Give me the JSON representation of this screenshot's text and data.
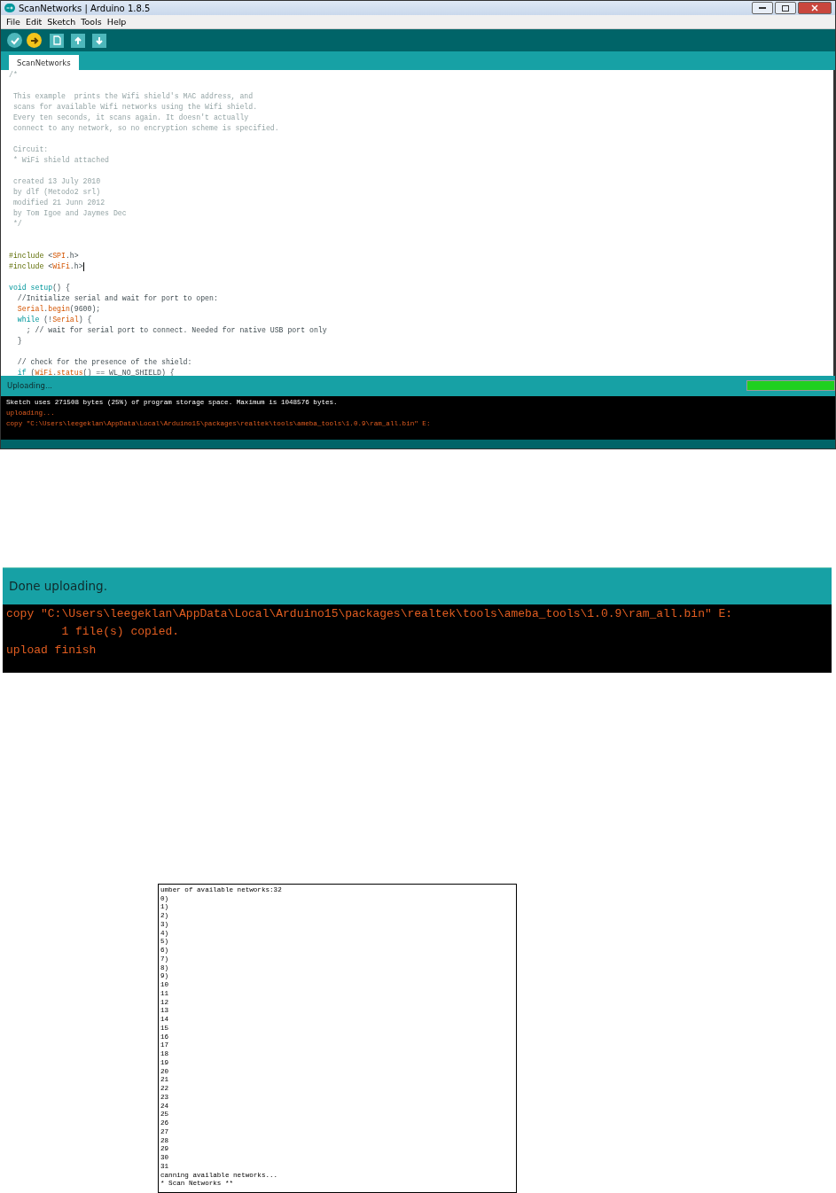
{
  "ide": {
    "window": {
      "title": "ScanNetworks | Arduino 1.8.5"
    },
    "menu": [
      "File",
      "Edit",
      "Sketch",
      "Tools",
      "Help"
    ],
    "toolbar": [
      {
        "kind": "verify",
        "active": false
      },
      {
        "kind": "upload",
        "active": true
      },
      {
        "kind": "new",
        "active": false
      },
      {
        "kind": "open",
        "active": false
      },
      {
        "kind": "save",
        "active": false
      }
    ],
    "tabs": [
      {
        "label": "ScanNetworks",
        "selected": true
      }
    ],
    "code": [
      {
        "segments": [
          {
            "kind": "comment",
            "text": "/*"
          }
        ]
      },
      {
        "kind": "blank"
      },
      {
        "segments": [
          {
            "kind": "comment",
            "text": " This example  prints the Wifi shield's MAC address, and"
          }
        ]
      },
      {
        "segments": [
          {
            "kind": "comment",
            "text": " scans for available Wifi networks using the Wifi shield."
          }
        ]
      },
      {
        "segments": [
          {
            "kind": "comment",
            "text": " Every ten seconds, it scans again. It doesn't actually"
          }
        ]
      },
      {
        "segments": [
          {
            "kind": "comment",
            "text": " connect to any network, so no encryption scheme is specified."
          }
        ]
      },
      {
        "kind": "blank"
      },
      {
        "segments": [
          {
            "kind": "comment",
            "text": " Circuit:"
          }
        ]
      },
      {
        "segments": [
          {
            "kind": "comment",
            "text": " * WiFi shield attached"
          }
        ]
      },
      {
        "kind": "blank"
      },
      {
        "segments": [
          {
            "kind": "comment",
            "text": " created 13 July 2010"
          }
        ]
      },
      {
        "segments": [
          {
            "kind": "comment",
            "text": " by dlf (Metodo2 srl)"
          }
        ]
      },
      {
        "segments": [
          {
            "kind": "comment",
            "text": " modified 21 Junn 2012"
          }
        ]
      },
      {
        "segments": [
          {
            "kind": "comment",
            "text": " by Tom Igoe and Jaymes Dec"
          }
        ]
      },
      {
        "segments": [
          {
            "kind": "comment",
            "text": " */"
          }
        ]
      },
      {
        "kind": "blank"
      },
      {
        "kind": "blank"
      },
      {
        "segments": [
          {
            "kind": "directive",
            "text": "#include "
          },
          {
            "kind": "plain",
            "text": "<"
          },
          {
            "kind": "library",
            "text": "SPI"
          },
          {
            "kind": "plain",
            "text": ".h>"
          }
        ]
      },
      {
        "segments": [
          {
            "kind": "directive",
            "text": "#include "
          },
          {
            "kind": "plain",
            "text": "<"
          },
          {
            "kind": "library",
            "text": "WiFi"
          },
          {
            "kind": "plain",
            "text": ".h>"
          }
        ],
        "cursor": true
      },
      {
        "kind": "blank"
      },
      {
        "segments": [
          {
            "kind": "keyword",
            "text": "void setup"
          },
          {
            "kind": "plain",
            "text": "() {"
          }
        ]
      },
      {
        "segments": [
          {
            "kind": "plain",
            "text": "  //Initialize serial and wait for port to open:"
          }
        ]
      },
      {
        "segments": [
          {
            "kind": "library",
            "text": "  Serial"
          },
          {
            "kind": "plain",
            "text": "."
          },
          {
            "kind": "library",
            "text": "begin"
          },
          {
            "kind": "plain",
            "text": "(9600);"
          }
        ]
      },
      {
        "segments": [
          {
            "kind": "keyword",
            "text": "  while"
          },
          {
            "kind": "plain",
            "text": " (!"
          },
          {
            "kind": "library",
            "text": "Serial"
          },
          {
            "kind": "plain",
            "text": ") {"
          }
        ]
      },
      {
        "segments": [
          {
            "kind": "plain",
            "text": "    ; // wait for serial port to connect. Needed for native USB port only"
          }
        ]
      },
      {
        "segments": [
          {
            "kind": "plain",
            "text": "  }"
          }
        ]
      },
      {
        "kind": "blank"
      },
      {
        "segments": [
          {
            "kind": "plain",
            "text": "  // check for the presence of the shield:"
          }
        ]
      },
      {
        "segments": [
          {
            "kind": "keyword",
            "text": "  if"
          },
          {
            "kind": "plain",
            "text": " ("
          },
          {
            "kind": "library",
            "text": "WiFi"
          },
          {
            "kind": "plain",
            "text": "."
          },
          {
            "kind": "library",
            "text": "status"
          },
          {
            "kind": "plain",
            "text": "() == WL_NO_SHIELD) {"
          }
        ]
      }
    ],
    "status": {
      "text": "Uploading...",
      "progress": {
        "level": 1
      }
    },
    "console": [
      {
        "kind": "info",
        "text": "Sketch uses 271508 bytes (25%) of program storage space. Maximum is 1048576 bytes."
      },
      {
        "kind": "error",
        "text": "uploading..."
      },
      {
        "kind": "error",
        "text": "copy \"C:\\Users\\leegeklan\\AppData\\Local\\Arduino15\\packages\\realtek\\tools\\ameba_tools\\1.0.9\\ram_all.bin\" E:"
      }
    ]
  },
  "done_panel": {
    "status": "Done uploading.",
    "console": [
      {
        "kind": "error",
        "text": "copy \"C:\\Users\\leegeklan\\AppData\\Local\\Arduino15\\packages\\realtek\\tools\\ameba_tools\\1.0.9\\ram_all.bin\" E:"
      },
      {
        "kind": "error",
        "text": "        1 file(s) copied."
      },
      {
        "kind": "error",
        "text": "upload finish"
      }
    ]
  },
  "serial_monitor": {
    "lines": [
      "umber of available networks:32",
      "0)",
      "1)",
      "2)",
      "3)",
      "4)",
      "5)",
      "6)",
      "7)",
      "8)",
      "9)",
      "10",
      "11",
      "12",
      "13",
      "14",
      "15",
      "16",
      "17",
      "18",
      "19",
      "20",
      "21",
      "22",
      "23",
      "24",
      "25",
      "26",
      "27",
      "28",
      "29",
      "30",
      "31",
      "canning available networks...",
      "* Scan Networks **"
    ]
  }
}
